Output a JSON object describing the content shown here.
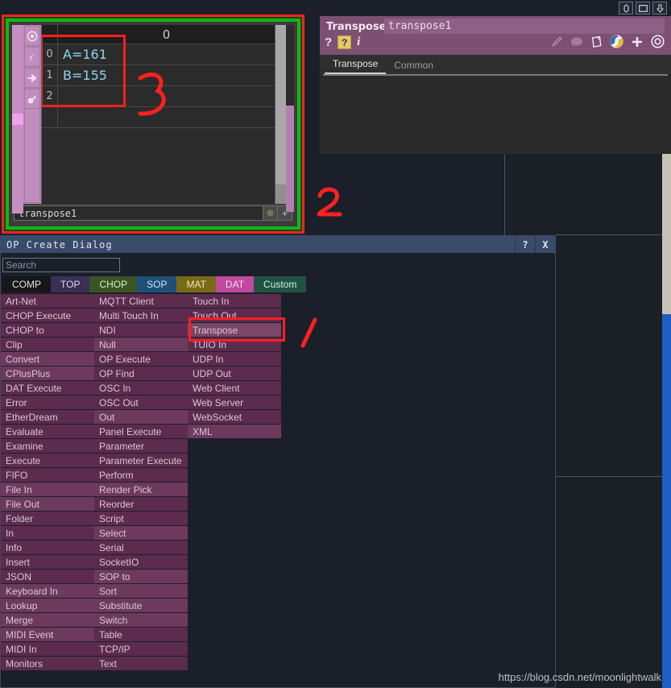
{
  "window": {
    "buttons": [
      {
        "name": "restore-button",
        "glyph": "0"
      },
      {
        "name": "maximize-button",
        "glyph": "▭"
      },
      {
        "name": "minimize-button",
        "glyph": "⇩"
      }
    ]
  },
  "dat_viewer": {
    "path_value": "transpose1",
    "tools": [
      "viewer-active-icon",
      "lightning-icon",
      "arrow-right-icon",
      "lock-icon"
    ],
    "footer_buttons": [
      "node-dot-icon",
      "plus-icon"
    ],
    "table": {
      "header": [
        "",
        "0"
      ],
      "rows": [
        {
          "index": "0",
          "value": "A=161"
        },
        {
          "index": "1",
          "value": "B=155"
        },
        {
          "index": "2",
          "value": ""
        },
        {
          "index": "",
          "value": ""
        }
      ]
    }
  },
  "parameters": {
    "op_type": "Transpose",
    "op_name": "transpose1",
    "left_icons": [
      "help-icon",
      "help-badge-icon",
      "info-icon"
    ],
    "right_icons": [
      "pencil-icon",
      "comment-icon",
      "clipboard-icon",
      "python-icon",
      "plus-icon",
      "target-icon"
    ],
    "tabs": [
      {
        "label": "Transpose",
        "active": true
      },
      {
        "label": "Common",
        "active": false
      }
    ]
  },
  "op_create_dialog": {
    "title": "OP Create Dialog",
    "title_buttons": [
      {
        "name": "help-button",
        "label": "?"
      },
      {
        "name": "close-button",
        "label": "X"
      }
    ],
    "search": {
      "value": "",
      "placeholder": "Search"
    },
    "tabs": [
      {
        "label": "COMP",
        "bg": "#17171a",
        "fg": "#e4e4e4"
      },
      {
        "label": "TOP",
        "bg": "#3a2f55",
        "fg": "#ded6ee"
      },
      {
        "label": "CHOP",
        "bg": "#3a5424",
        "fg": "#dcecc9"
      },
      {
        "label": "SOP",
        "bg": "#1e4f78",
        "fg": "#cfe2f2"
      },
      {
        "label": "MAT",
        "bg": "#7a6a16",
        "fg": "#efe6c0"
      },
      {
        "label": "DAT",
        "bg": "#c0489e",
        "fg": "#f7dcef"
      },
      {
        "label": "Custom",
        "bg": "#1f5443",
        "fg": "#d6ece2"
      }
    ],
    "active_tab": "DAT",
    "columns": [
      {
        "items": [
          "Art-Net",
          "CHOP Execute",
          "CHOP to",
          "Clip",
          "Convert",
          "CPlusPlus",
          "DAT Execute",
          "Error",
          "EtherDream",
          "Evaluate",
          "Examine",
          "Execute",
          "FIFO",
          "File In",
          "File Out",
          "Folder",
          "In",
          "Info",
          "Insert",
          "JSON",
          "Keyboard In",
          "Lookup",
          "Merge",
          "MIDI Event",
          "MIDI In",
          "Monitors"
        ]
      },
      {
        "items": [
          "MQTT Client",
          "Multi Touch In",
          "NDI",
          "Null",
          "OP Execute",
          "OP Find",
          "OSC In",
          "OSC Out",
          "Out",
          "Panel Execute",
          "Parameter",
          "Parameter Execute",
          "Perform",
          "Render Pick",
          "Reorder",
          "Script",
          "Select",
          "Serial",
          "SocketIO",
          "SOP to",
          "Sort",
          "Substitute",
          "Switch",
          "Table",
          "TCP/IP",
          "Text"
        ]
      },
      {
        "items": [
          "Touch In",
          "Touch Out",
          "Transpose",
          "TUIO In",
          "UDP In",
          "UDP Out",
          "Web Client",
          "Web Server",
          "WebSocket",
          "XML"
        ]
      }
    ],
    "highlighted_item": "Transpose"
  },
  "annotations": {
    "marker_1": "1",
    "marker_2": "2",
    "marker_3": "3",
    "color": "#ff2020"
  },
  "watermark": "https://blog.csdn.net/moonlightwalk"
}
